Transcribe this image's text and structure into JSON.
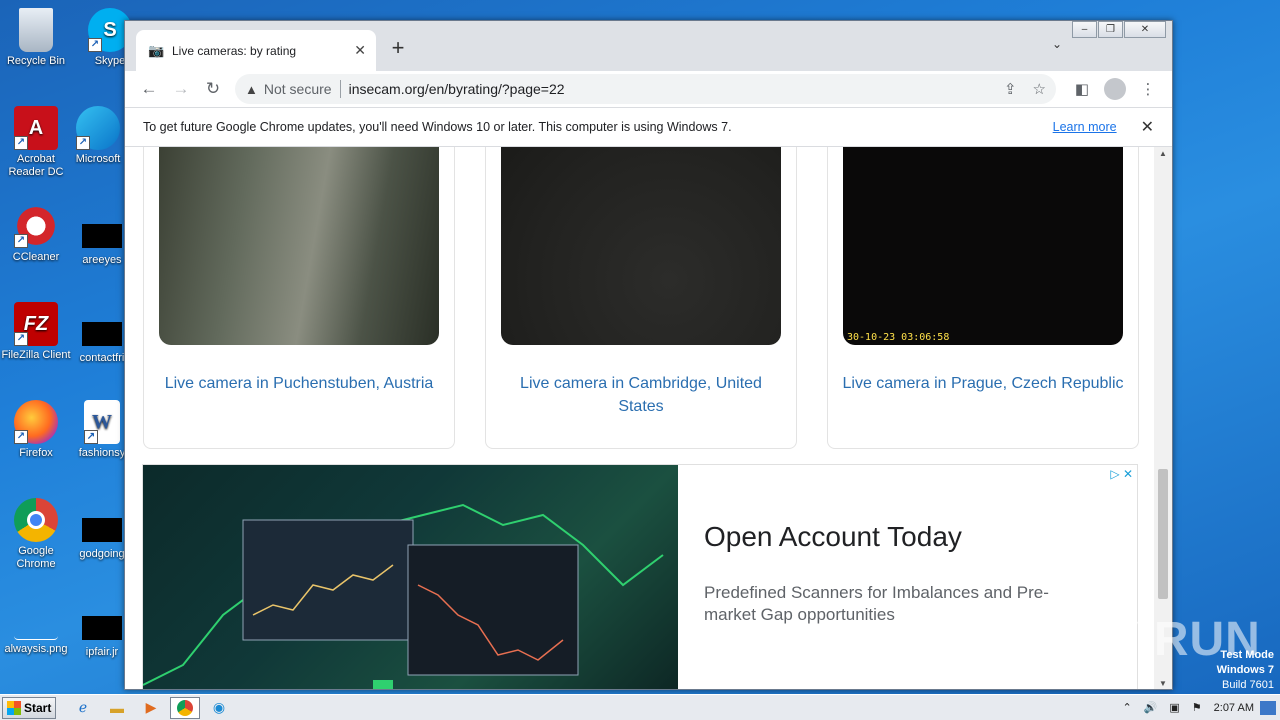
{
  "desktop": {
    "icons": [
      {
        "label": "Recycle Bin",
        "name": "recycle-bin-icon"
      },
      {
        "label": "Skype",
        "name": "skype-icon"
      },
      {
        "label": "Acrobat Reader DC",
        "name": "acrobat-icon"
      },
      {
        "label": "Microsoft",
        "name": "edge-icon"
      },
      {
        "label": "CCleaner",
        "name": "ccleaner-icon"
      },
      {
        "label": "areeyes",
        "name": "file-icon"
      },
      {
        "label": "FileZilla Client",
        "name": "filezilla-icon"
      },
      {
        "label": "contactfri",
        "name": "file-icon"
      },
      {
        "label": "Firefox",
        "name": "firefox-icon"
      },
      {
        "label": "fashionsy",
        "name": "word-doc-icon"
      },
      {
        "label": "Google Chrome",
        "name": "chrome-icon"
      },
      {
        "label": "godgoing",
        "name": "file-icon"
      },
      {
        "label": "alwaysis.png",
        "name": "image-file-icon"
      },
      {
        "label": "ipfair.jr",
        "name": "file-icon"
      }
    ]
  },
  "browser": {
    "tab_title": "Live cameras: by rating",
    "url": "insecam.org/en/byrating/?page=22",
    "not_secure": "Not secure",
    "infobar_message": "To get future Google Chrome updates, you'll need Windows 10 or later. This computer is using Windows 7.",
    "infobar_link": "Learn more"
  },
  "page": {
    "cameras": [
      {
        "caption": "Live camera in Puchenstuben, Austria"
      },
      {
        "caption": "Live camera in Cambridge, United States"
      },
      {
        "caption": "Live camera in Prague, Czech Republic",
        "timestamp": "30-10-23 03:06:58"
      }
    ],
    "ad": {
      "title": "Open Account Today",
      "description": "Predefined Scanners for Imbalances and Pre-market Gap opportunities"
    }
  },
  "watermark": {
    "logo": "ANY RUN",
    "line1": "Test Mode",
    "line2": "Windows 7",
    "line3": "Build 7601"
  },
  "taskbar": {
    "start_label": "Start",
    "clock": "2:07 AM"
  }
}
